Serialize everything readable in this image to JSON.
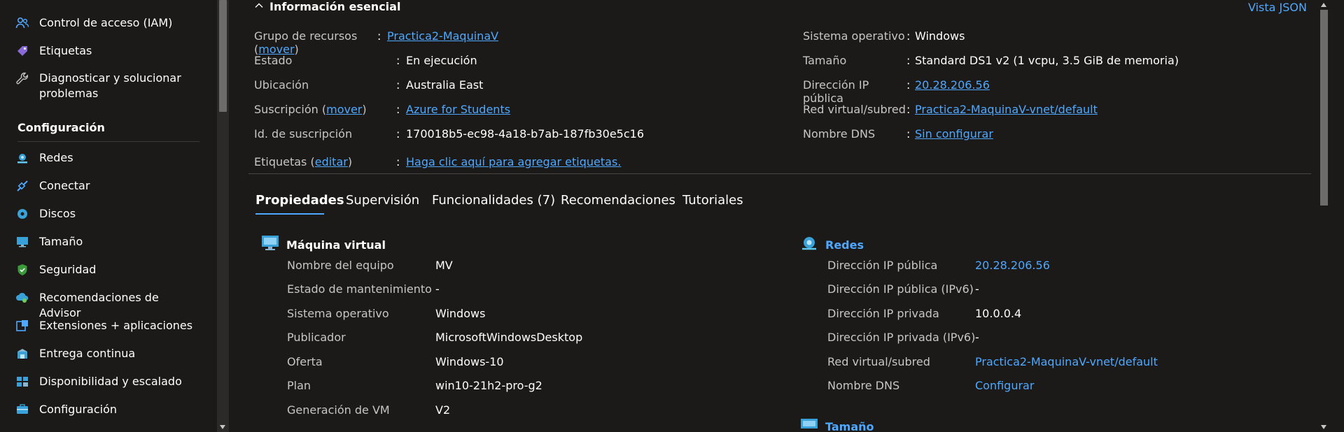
{
  "sidebar": {
    "items_top": [
      {
        "label": "Control de acceso (IAM)",
        "icon": "people-icon"
      },
      {
        "label": "Etiquetas",
        "icon": "tag-icon"
      },
      {
        "label": "Diagnosticar y solucionar problemas",
        "icon": "wrench-icon"
      }
    ],
    "section_label": "Configuración",
    "items": [
      {
        "label": "Redes",
        "icon": "network-icon"
      },
      {
        "label": "Conectar",
        "icon": "connect-icon"
      },
      {
        "label": "Discos",
        "icon": "disk-icon"
      },
      {
        "label": "Tamaño",
        "icon": "monitor-icon"
      },
      {
        "label": "Seguridad",
        "icon": "shield-icon"
      },
      {
        "label": "Recomendaciones de Advisor",
        "icon": "advisor-icon"
      },
      {
        "label": "Extensiones + aplicaciones",
        "icon": "extensions-icon"
      },
      {
        "label": "Entrega continua",
        "icon": "delivery-icon"
      },
      {
        "label": "Disponibilidad y escalado",
        "icon": "availability-icon"
      },
      {
        "label": "Configuración",
        "icon": "configuration-icon"
      }
    ]
  },
  "essentials": {
    "header": "Información esencial",
    "json_view": "Vista JSON",
    "left": [
      {
        "key": "Grupo de recursos",
        "action": "mover",
        "value": "Practica2-MaquinaV",
        "is_link": true
      },
      {
        "key": "Estado",
        "action": "",
        "value": "En ejecución",
        "is_link": false
      },
      {
        "key": "Ubicación",
        "action": "",
        "value": "Australia East",
        "is_link": false
      },
      {
        "key": "Suscripción",
        "action": "mover",
        "value": "Azure for Students",
        "is_link": true
      },
      {
        "key": "Id. de suscripción",
        "action": "",
        "value": "170018b5-ec98-4a18-b7ab-187fb30e5c16",
        "is_link": false
      }
    ],
    "right": [
      {
        "key": "Sistema operativo",
        "value": "Windows",
        "is_link": false
      },
      {
        "key": "Tamaño",
        "value": "Standard DS1 v2 (1 vcpu, 3.5 GiB de memoria)",
        "is_link": false
      },
      {
        "key": "Dirección IP pública",
        "value": "20.28.206.56",
        "is_link": true
      },
      {
        "key": "Red virtual/subred",
        "value": "Practica2-MaquinaV-vnet/default",
        "is_link": true
      },
      {
        "key": "Nombre DNS",
        "value": "Sin configurar",
        "is_link": true
      }
    ],
    "tags": {
      "key": "Etiquetas",
      "action": "editar",
      "value": "Haga clic aquí para agregar etiquetas."
    }
  },
  "tabs": [
    {
      "label": "Propiedades",
      "active": true
    },
    {
      "label": "Supervisión",
      "active": false
    },
    {
      "label": "Funcionalidades (7)",
      "active": false
    },
    {
      "label": "Recomendaciones",
      "active": false
    },
    {
      "label": "Tutoriales",
      "active": false
    }
  ],
  "vm_section": {
    "title": "Máquina virtual",
    "rows": [
      {
        "key": "Nombre del equipo",
        "value": "MV"
      },
      {
        "key": "Estado de mantenimiento",
        "value": "-"
      },
      {
        "key": "Sistema operativo",
        "value": "Windows"
      },
      {
        "key": "Publicador",
        "value": "MicrosoftWindowsDesktop"
      },
      {
        "key": "Oferta",
        "value": "Windows-10"
      },
      {
        "key": "Plan",
        "value": "win10-21h2-pro-g2"
      },
      {
        "key": "Generación de VM",
        "value": "V2"
      }
    ]
  },
  "network_section": {
    "title": "Redes",
    "rows": [
      {
        "key": "Dirección IP pública",
        "value": "20.28.206.56",
        "is_link": true
      },
      {
        "key": "Dirección IP pública (IPv6)",
        "value": "-",
        "is_link": false
      },
      {
        "key": "Dirección IP privada",
        "value": "10.0.0.4",
        "is_link": false
      },
      {
        "key": "Dirección IP privada (IPv6)",
        "value": "-",
        "is_link": false
      },
      {
        "key": "Red virtual/subred",
        "value": "Practica2-MaquinaV-vnet/default",
        "is_link": true
      },
      {
        "key": "Nombre DNS",
        "value": "Configurar",
        "is_link": true
      }
    ]
  },
  "size_section": {
    "title": "Tamaño"
  },
  "colors": {
    "accent": "#4fa8ff",
    "background": "#1b1a19",
    "muted_text": "#c8c6c4"
  }
}
